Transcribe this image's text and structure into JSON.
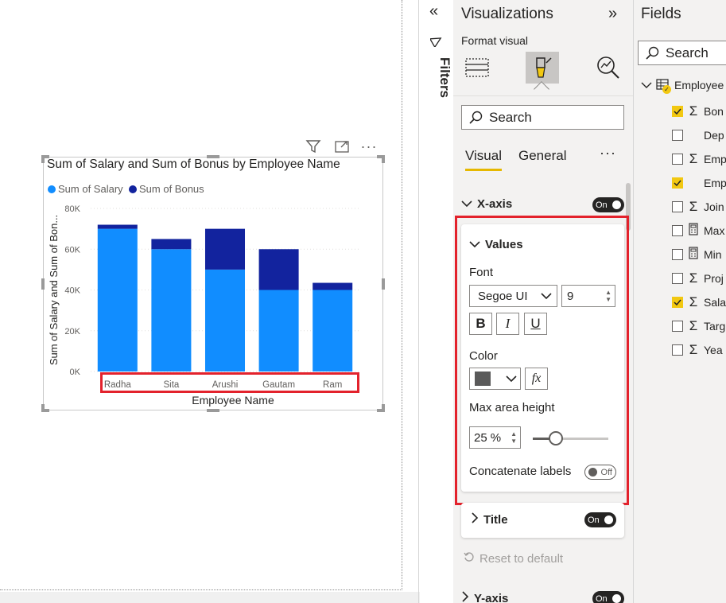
{
  "chart_data": {
    "type": "bar",
    "stacked": true,
    "title": "Sum of Salary and Sum of Bonus by Employee Name",
    "xlabel": "Employee Name",
    "ylabel": "Sum of Salary and Sum of Bon...",
    "categories": [
      "Radha",
      "Sita",
      "Arushi",
      "Gautam",
      "Ram"
    ],
    "series": [
      {
        "name": "Sum of Salary",
        "color": "#118DFF",
        "values": [
          70000,
          60000,
          50000,
          40000,
          40000
        ]
      },
      {
        "name": "Sum of Bonus",
        "color": "#12239E",
        "values": [
          2000,
          5000,
          20000,
          20000,
          3500
        ]
      }
    ],
    "ylim": [
      0,
      80000
    ],
    "yticks": [
      "0K",
      "20K",
      "40K",
      "60K",
      "80K"
    ],
    "ytick_values": [
      0,
      20000,
      40000,
      60000,
      80000
    ],
    "grid": true,
    "legend_position": "top-left"
  },
  "canvas": {
    "toolbar_icons": [
      "filter-icon",
      "focus-mode-icon",
      "more-options-icon"
    ],
    "more_glyph": "···"
  },
  "filters": {
    "label": "Filters"
  },
  "viz": {
    "title": "Visualizations",
    "collapse_glyph": "»",
    "format_visual": "Format visual",
    "search_placeholder": "Search",
    "tabs": {
      "visual": "Visual",
      "general": "General",
      "more": "···"
    },
    "xaxis": {
      "label": "X-axis",
      "toggle": "On"
    },
    "values": {
      "label": "Values",
      "font_label": "Font",
      "font_family": "Segoe UI",
      "font_size": "9",
      "bold": "B",
      "italic": "I",
      "underline": "U",
      "color_label": "Color",
      "color_value": "#5a5a5a",
      "fx": "fx",
      "max_area_label": "Max area height",
      "max_area_value": "25",
      "max_area_unit": "%",
      "max_area_fraction": 0.25,
      "concat_label": "Concatenate labels",
      "concat_toggle": "Off"
    },
    "title_card": {
      "label": "Title",
      "toggle": "On"
    },
    "reset": "Reset to default",
    "yaxis": {
      "label": "Y-axis",
      "toggle": "On"
    }
  },
  "fields": {
    "title": "Fields",
    "search_placeholder": "Search",
    "table_name": "Employee",
    "items": [
      {
        "label": "Bon",
        "checked": true,
        "kind": "sigma"
      },
      {
        "label": "Dep",
        "checked": false,
        "kind": "text"
      },
      {
        "label": "Emp",
        "checked": false,
        "kind": "sigma"
      },
      {
        "label": "Emp",
        "checked": true,
        "kind": "text"
      },
      {
        "label": "Join",
        "checked": false,
        "kind": "sigma"
      },
      {
        "label": "Max",
        "checked": false,
        "kind": "calc"
      },
      {
        "label": "Min",
        "checked": false,
        "kind": "calc"
      },
      {
        "label": "Proj",
        "checked": false,
        "kind": "sigma"
      },
      {
        "label": "Sala",
        "checked": true,
        "kind": "sigma"
      },
      {
        "label": "Targ",
        "checked": false,
        "kind": "sigma"
      },
      {
        "label": "Yea",
        "checked": false,
        "kind": "sigma"
      }
    ]
  }
}
